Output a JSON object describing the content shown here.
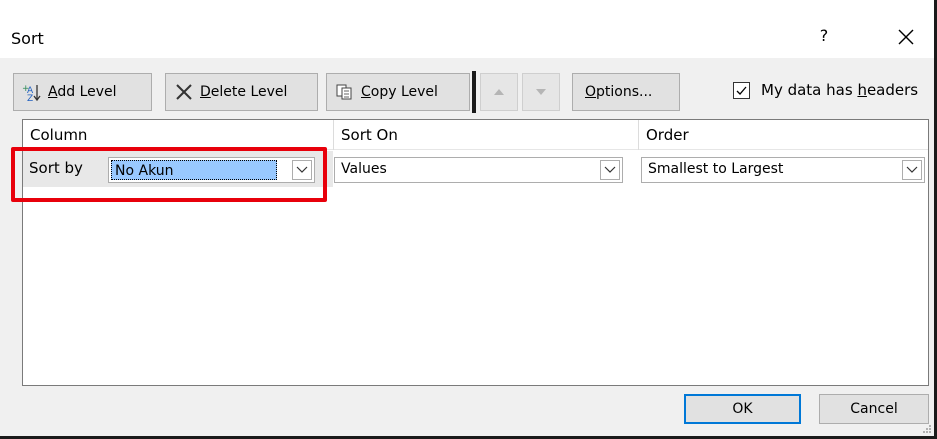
{
  "dialog": {
    "title": "Sort",
    "help_label": "?",
    "close_label": "×"
  },
  "toolbar": {
    "add_level_underline": "A",
    "add_level_rest": "dd Level",
    "delete_level_underline": "D",
    "delete_level_rest": "elete Level",
    "copy_level_underline": "C",
    "copy_level_rest": "opy Level",
    "options_underline": "O",
    "options_rest": "ptions...",
    "headers_label_pre": "My data has ",
    "headers_underline": "h",
    "headers_label_post": "eaders",
    "headers_checked": true
  },
  "grid": {
    "columns": [
      "Column",
      "Sort On",
      "Order"
    ],
    "rows": [
      {
        "label": "Sort by",
        "column_value": "No Akun",
        "sort_on_value": "Values",
        "order_value": "Smallest to Largest"
      }
    ]
  },
  "footer": {
    "ok_label": "OK",
    "cancel_label": "Cancel"
  },
  "colors": {
    "highlight_border": "#e8000b",
    "selection_fill": "#99c9ff",
    "default_button_border": "#0078d7"
  }
}
